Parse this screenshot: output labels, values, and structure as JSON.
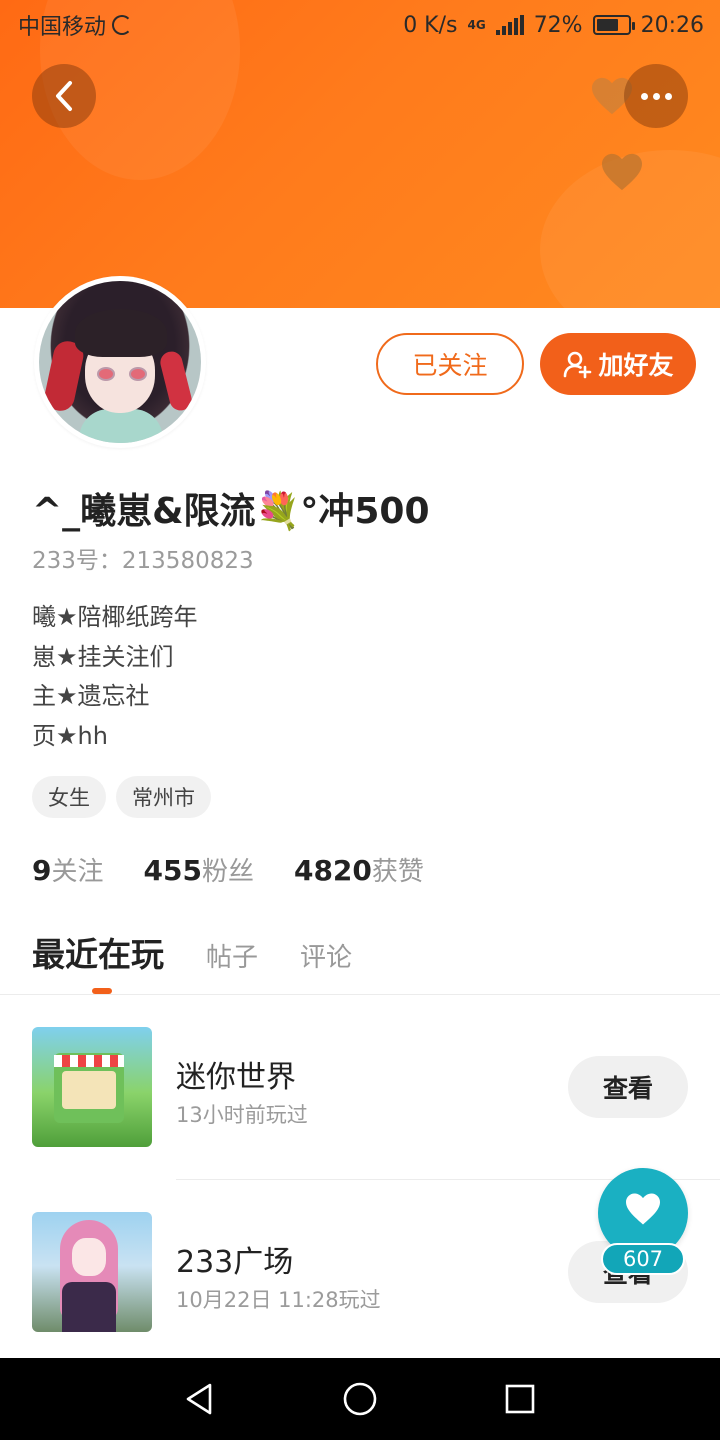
{
  "status_bar": {
    "carrier": "中国移动",
    "net_speed": "0 K/s",
    "net_type": "4G",
    "battery": "72%",
    "time": "20:26"
  },
  "header": {
    "back_icon": "back-arrow-icon",
    "more_icon": "more-dots-icon",
    "accent_color": "#ff7418"
  },
  "profile": {
    "username": "^_曦崽&限流💐°冲500",
    "id_label": "233号：",
    "id_value": "213580823",
    "bio": [
      "曦★陪椰纸跨年",
      "崽★挂关注们",
      "主★遗忘社",
      "页★hh"
    ],
    "tags": [
      "女生",
      "常州市"
    ],
    "follow_button": "已关注",
    "add_friend_button": "加好友",
    "stats": [
      {
        "num": "9",
        "label": "关注"
      },
      {
        "num": "455",
        "label": "粉丝"
      },
      {
        "num": "4820",
        "label": "获赞"
      }
    ]
  },
  "tabs": [
    "最近在玩",
    "帖子",
    "评论"
  ],
  "games": [
    {
      "name": "迷你世界",
      "time": "13小时前玩过",
      "button": "查看"
    },
    {
      "name": "233广场",
      "time": "10月22日 11:28玩过",
      "button": "查看"
    }
  ],
  "like_fab": {
    "count": "607",
    "color": "#1ab0c2"
  },
  "nav": {
    "back": "nav-back-icon",
    "home": "nav-home-icon",
    "recent": "nav-recents-icon"
  }
}
